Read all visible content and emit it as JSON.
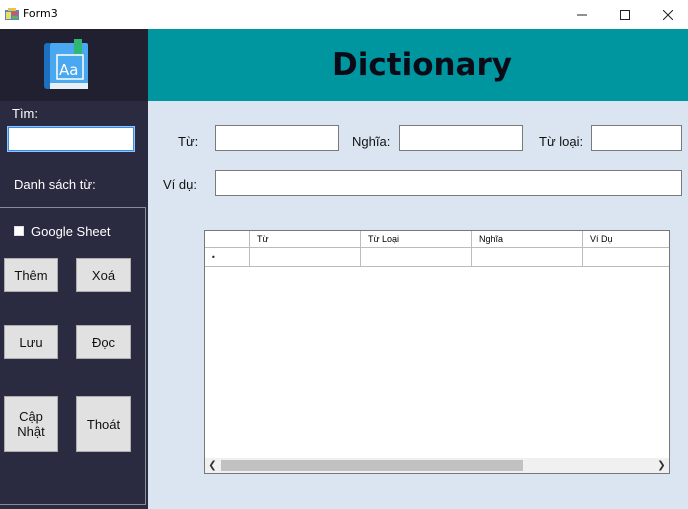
{
  "window": {
    "title": "Form3",
    "minimize_glyph": "–",
    "maximize_glyph": "☐",
    "close_glyph": "✕"
  },
  "header": {
    "title": "Dictionary",
    "logo_icon": "dictionary-book-icon"
  },
  "sidebar": {
    "search_label": "Tìm:",
    "search_value": "",
    "word_list_label": "Danh sách từ:",
    "google_sheet_label": "Google Sheet",
    "google_sheet_checked": false,
    "buttons": {
      "add": "Thêm",
      "delete": "Xoá",
      "save": "Lưu",
      "read": "Đọc",
      "update": "Cập\nNhật",
      "exit": "Thoát"
    }
  },
  "form": {
    "word_label": "Từ:",
    "meaning_label": "Nghĩa:",
    "word_type_label": "Từ loại:",
    "example_label": "Ví dụ:",
    "word_value": "",
    "meaning_value": "",
    "word_type_value": "",
    "example_value": ""
  },
  "grid": {
    "columns": [
      "Từ",
      "Từ Loại",
      "Nghĩa",
      "Ví Dụ"
    ],
    "new_row_marker": "•",
    "rows": []
  },
  "colors": {
    "sidebar_bg": "#2a2a40",
    "logo_bg": "#202030",
    "header_bg": "#0096a0",
    "main_bg": "#dbe5f1",
    "search_border": "#3c8ce0"
  }
}
